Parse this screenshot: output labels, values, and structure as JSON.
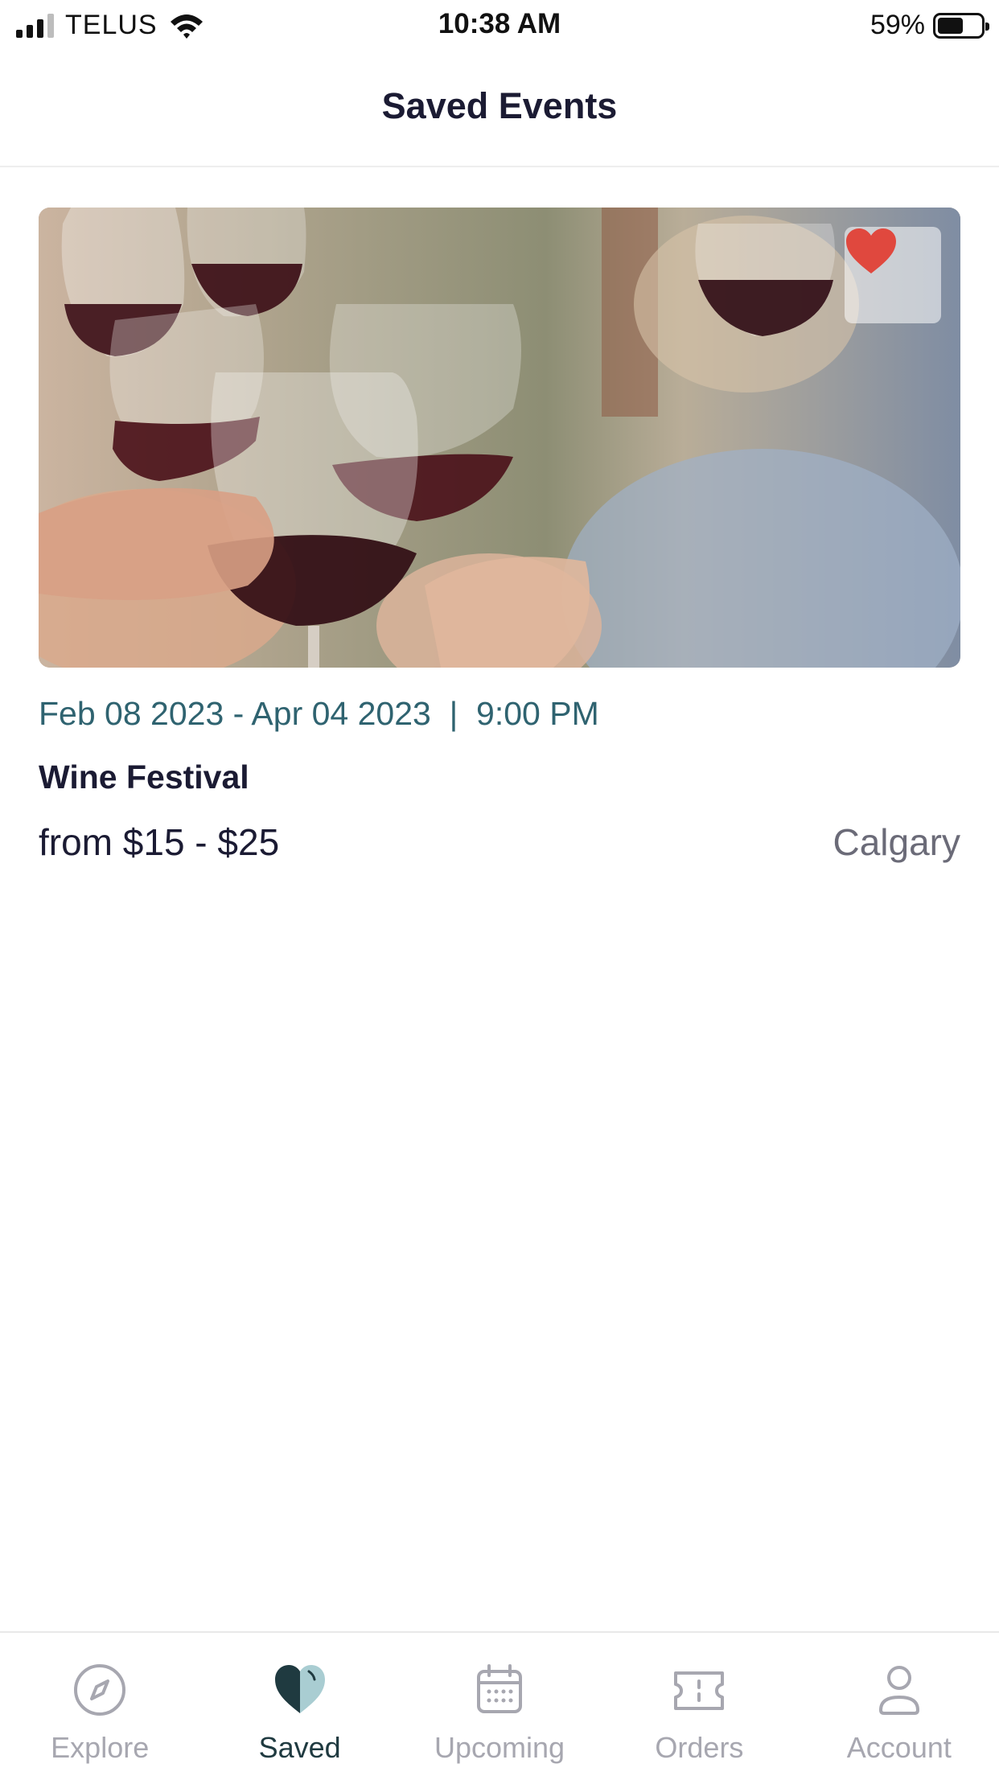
{
  "status_bar": {
    "carrier": "TELUS",
    "time": "10:38 AM",
    "battery": "59%",
    "battery_level": 0.59
  },
  "header": {
    "title": "Saved Events"
  },
  "events": [
    {
      "dates": "Feb 08 2023 - Apr 04 2023  |  9:00 PM",
      "name": "Wine Festival",
      "price": "from $15 - $25",
      "city": "Calgary",
      "favorited": true,
      "favorite_color": "#e0483e"
    }
  ],
  "tab_bar": {
    "tabs": [
      {
        "label": "Explore",
        "icon": "compass-icon",
        "active": false
      },
      {
        "label": "Saved",
        "icon": "heart-icon",
        "active": true
      },
      {
        "label": "Upcoming",
        "icon": "calendar-icon",
        "active": false
      },
      {
        "label": "Orders",
        "icon": "ticket-icon",
        "active": false
      },
      {
        "label": "Account",
        "icon": "person-icon",
        "active": false
      }
    ]
  },
  "colors": {
    "accent": "#2f6370",
    "active_tab": "#1f3a40",
    "inactive_tab": "#a7a7b0"
  }
}
